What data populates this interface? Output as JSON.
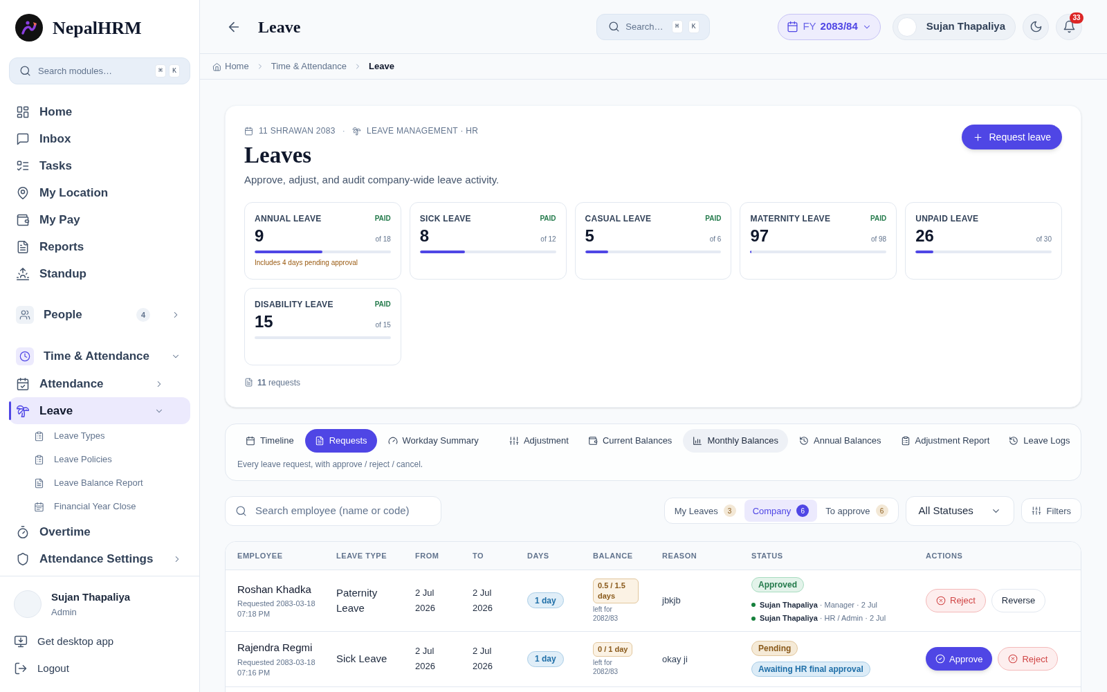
{
  "sidebar": {
    "brand": "NepalHRM",
    "search": {
      "placeholder": "Search modules…",
      "keys": [
        "⌘",
        "K"
      ]
    },
    "nav": [
      {
        "label": "Home",
        "kind": "link",
        "selected": false
      },
      {
        "label": "Inbox",
        "kind": "link",
        "selected": false
      },
      {
        "label": "Tasks",
        "kind": "link",
        "selected": false
      },
      {
        "label": "My Location",
        "kind": "link",
        "selected": false
      },
      {
        "label": "My Pay",
        "kind": "link",
        "selected": false
      },
      {
        "label": "Reports",
        "kind": "link",
        "selected": false
      },
      {
        "label": "Standup",
        "kind": "link",
        "selected": false
      },
      {
        "label": "People",
        "kind": "group",
        "badge": "4",
        "expanded": false,
        "selected": false
      },
      {
        "label": "Time & Attendance",
        "kind": "group",
        "expanded": true,
        "selected": false,
        "children": [
          {
            "label": "Attendance",
            "kind": "group",
            "expanded": false,
            "selected": false
          },
          {
            "label": "Leave",
            "kind": "group",
            "expanded": true,
            "selected": true,
            "children": [
              {
                "label": "Leave Types",
                "kind": "sub",
                "selected": false
              },
              {
                "label": "Leave Policies",
                "kind": "sub",
                "selected": false
              },
              {
                "label": "Leave Balance Report",
                "kind": "sub",
                "selected": false
              },
              {
                "label": "Financial Year Close",
                "kind": "sub",
                "selected": false
              }
            ]
          },
          {
            "label": "Overtime",
            "kind": "link",
            "selected": false
          },
          {
            "label": "Attendance Settings",
            "kind": "group",
            "expanded": false,
            "selected": false
          }
        ]
      }
    ],
    "user": {
      "name": "Sujan Thapaliya",
      "role": "Admin"
    },
    "footer_links": [
      "Get desktop app",
      "Logout"
    ]
  },
  "header": {
    "title": "Leave",
    "search": {
      "placeholder": "Search…",
      "keys": [
        "⌘",
        "K"
      ]
    },
    "fiscal_year": {
      "prefix": "FY",
      "value": "2083/84"
    },
    "user": "Sujan Thapaliya",
    "notifications": "33"
  },
  "breadcrumb": [
    "Home",
    "Time & Attendance",
    "Leave"
  ],
  "overview": {
    "date": "11 SHRAWAN 2083",
    "separator": "·",
    "module": "LEAVE MANAGEMENT · HR",
    "title": "Leaves",
    "subtitle": "Approve, adjust, and audit company-wide leave activity.",
    "action": "Request leave",
    "balances": [
      {
        "name": "ANNUAL LEAVE",
        "tag": "PAID",
        "value": "9",
        "total": "of 18",
        "level": 0.5,
        "note": "Includes 4 days pending approval"
      },
      {
        "name": "SICK LEAVE",
        "tag": "PAID",
        "value": "8",
        "total": "of 12",
        "level": 0.33
      },
      {
        "name": "CASUAL LEAVE",
        "tag": "PAID",
        "value": "5",
        "total": "of 6",
        "level": 0.17
      },
      {
        "name": "MATERNITY LEAVE",
        "tag": "PAID",
        "value": "97",
        "total": "of 98",
        "level": 0.01
      },
      {
        "name": "UNPAID LEAVE",
        "value": "26",
        "total": "of 30",
        "level": 0.13
      },
      {
        "name": "DISABILITY LEAVE",
        "tag": "PAID",
        "value": "15",
        "total": "of 15",
        "level": 0
      }
    ],
    "requests_count": "**11** requests"
  },
  "tabs": [
    {
      "label": "Timeline",
      "selected": false,
      "hovered": false
    },
    {
      "label": "Requests",
      "selected": true,
      "hovered": false
    },
    {
      "label": "Workday Summary",
      "selected": false,
      "hovered": false
    },
    {
      "label": "Adjustment",
      "selected": false,
      "hovered": false
    },
    {
      "label": "Current Balances",
      "selected": false,
      "hovered": false
    },
    {
      "label": "Monthly Balances",
      "selected": false,
      "hovered": true
    },
    {
      "label": "Annual Balances",
      "selected": false,
      "hovered": false
    },
    {
      "label": "Adjustment Report",
      "selected": false,
      "hovered": false
    },
    {
      "label": "Leave Logs",
      "selected": false,
      "hovered": false
    }
  ],
  "tab_hint": "Every leave request, with approve / reject / cancel.",
  "filters": {
    "search_placeholder": "Search employee (name or code)",
    "scopes": [
      {
        "label": "My Leaves",
        "count": "3",
        "selected": false
      },
      {
        "label": "Company",
        "count": "6",
        "selected": true
      },
      {
        "label": "To approve",
        "count": "6",
        "selected": false
      }
    ],
    "status": "All Statuses",
    "button": "Filters"
  },
  "table": {
    "columns": [
      "EMPLOYEE",
      "LEAVE TYPE",
      "FROM",
      "TO",
      "DAYS",
      "BALANCE",
      "REASON",
      "STATUS",
      "ACTIONS"
    ],
    "rows": [
      {
        "employee": "Roshan Khadka",
        "requested": "Requested 2083-03-18 07:18 PM",
        "leave_type": "Paternity Leave",
        "from": "2 Jul 2026",
        "to": "2 Jul 2026",
        "days": "1 day",
        "balance": "0.5 / 1.5 days",
        "balance_note": "left for 2082/83",
        "reason": "jbkjb",
        "statuses": [
          {
            "label": "Approved",
            "kind": "approved"
          }
        ],
        "approvals": [
          {
            "name": "Sujan Thapaliya",
            "detail": "· Manager · 2 Jul"
          },
          {
            "name": "Sujan Thapaliya",
            "detail": "· HR / Admin · 2 Jul"
          }
        ],
        "actions": [
          {
            "label": "Reject",
            "kind": "reject"
          },
          {
            "label": "Reverse",
            "kind": "reverse"
          }
        ]
      },
      {
        "employee": "Rajendra Regmi",
        "requested": "Requested 2083-03-18 07:16 PM",
        "leave_type": "Sick Leave",
        "from": "2 Jul 2026",
        "to": "2 Jul 2026",
        "days": "1 day",
        "balance": "0 / 1 day",
        "balance_note": "left for 2082/83",
        "reason": "okay ji",
        "statuses": [
          {
            "label": "Pending",
            "kind": "pending"
          },
          {
            "label": "Awaiting HR final approval",
            "kind": "info"
          }
        ],
        "actions": [
          {
            "label": "Approve",
            "kind": "approve"
          },
          {
            "label": "Reject",
            "kind": "reject"
          }
        ]
      }
    ]
  }
}
